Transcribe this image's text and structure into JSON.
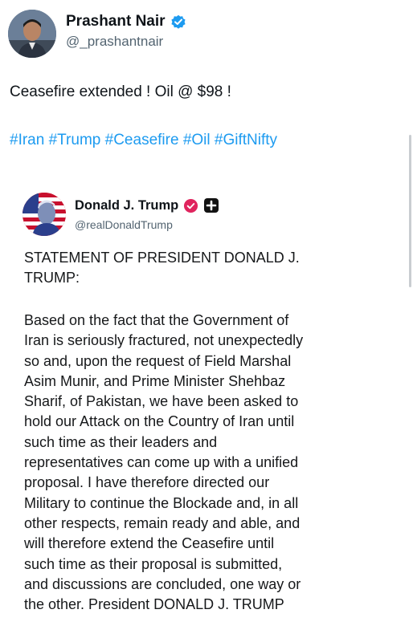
{
  "post": {
    "author": {
      "display_name": "Prashant Nair",
      "handle": "@_prashantnair",
      "verified_badge_color": "#1d9bf0",
      "avatar_icon": "profile-photo"
    },
    "text": "Ceasefire extended ! Oil @ $98 !",
    "hashtags": [
      "#Iran",
      "#Trump",
      "#Ceasefire",
      "#Oil",
      "#GiftNifty"
    ],
    "hashtag_color": "#1d9bf0"
  },
  "quoted_post": {
    "author": {
      "display_name": "Donald J. Trump",
      "handle": "@realDonaldTrump",
      "badge_color": "#e0245e",
      "avatar_icon": "profile-photo"
    },
    "title_lines": [
      "STATEMENT OF PRESIDENT DONALD J.",
      "TRUMP:"
    ],
    "body_lines": [
      "Based on the fact that the Government of",
      "Iran is seriously fractured, not unexpectedly",
      "so and, upon the request of Field Marshal",
      "Asim Munir, and Prime Minister Shehbaz",
      "Sharif, of Pakistan, we have been asked to",
      "hold our Attack on the Country of Iran until",
      "such time as their leaders and",
      "representatives can come up with a unified",
      "proposal. I have therefore directed our",
      "Military to continue the Blockade and, in all",
      "other respects, remain ready and able, and",
      "will therefore extend the Ceasefire until",
      "such time as their proposal is submitted,",
      "and discussions are concluded, one way or",
      "the other. President DONALD J. TRUMP"
    ]
  }
}
